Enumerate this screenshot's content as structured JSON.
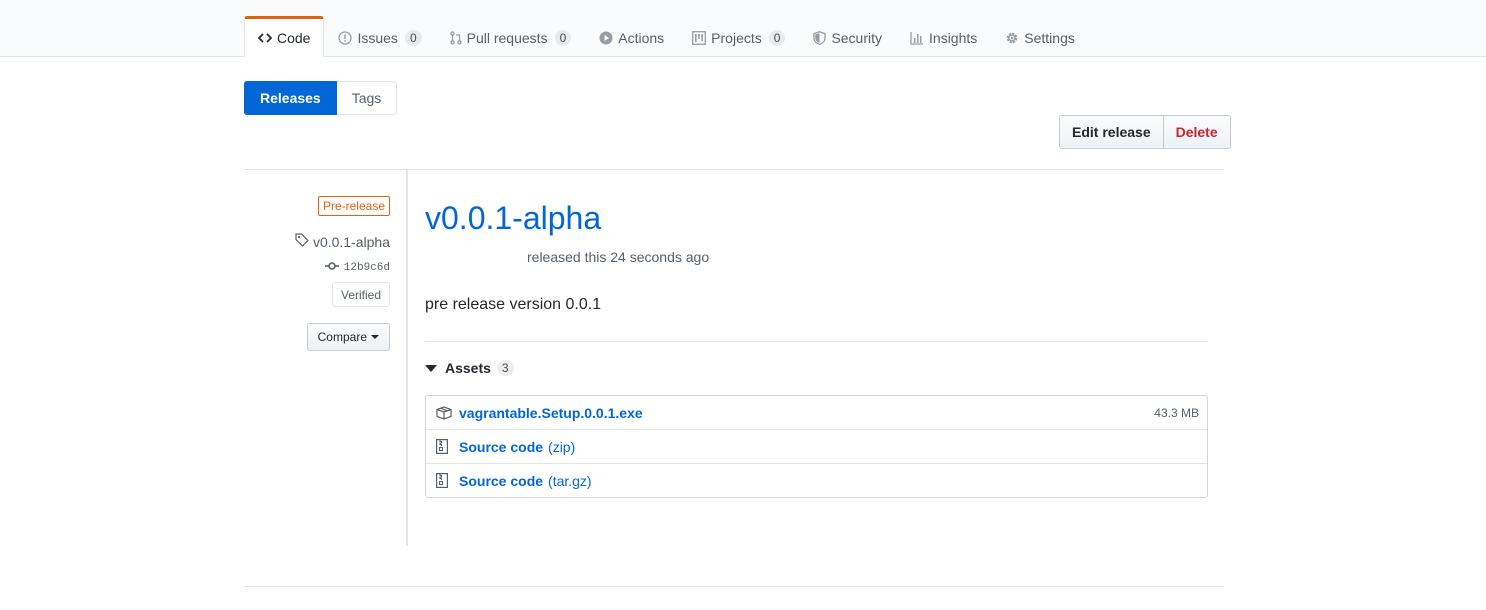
{
  "nav": {
    "tabs": [
      {
        "label": "Code",
        "counter": "",
        "icon": "code-icon"
      },
      {
        "label": "Issues",
        "counter": "0",
        "icon": "issue-icon"
      },
      {
        "label": "Pull requests",
        "counter": "0",
        "icon": "pull-request-icon"
      },
      {
        "label": "Actions",
        "counter": "",
        "icon": "play-icon"
      },
      {
        "label": "Projects",
        "counter": "0",
        "icon": "project-icon"
      },
      {
        "label": "Security",
        "counter": "",
        "icon": "shield-icon"
      },
      {
        "label": "Insights",
        "counter": "",
        "icon": "graph-icon"
      },
      {
        "label": "Settings",
        "counter": "",
        "icon": "gear-icon"
      }
    ],
    "selected_tab": "Code",
    "accent_color": "#e36209"
  },
  "subnav": {
    "releases_label": "Releases",
    "tags_label": "Tags"
  },
  "actions": {
    "edit_label": "Edit release",
    "delete_label": "Delete"
  },
  "release": {
    "prerelease_label": "Pre-release",
    "tag": "v0.0.1-alpha",
    "commit": "12b9c6d",
    "verified_label": "Verified",
    "compare_label": "Compare",
    "title": "v0.0.1-alpha",
    "byline": "released this 24 seconds ago",
    "description": "pre release version 0.0.1"
  },
  "assets": {
    "label": "Assets",
    "count": "3",
    "items": [
      {
        "name": "vagrantable.Setup.0.0.1.exe",
        "suffix": "",
        "size": "43.3 MB",
        "icon": "package-icon"
      },
      {
        "name": "Source code",
        "suffix": "(zip)",
        "size": "",
        "icon": "file-zip-icon"
      },
      {
        "name": "Source code",
        "suffix": "(tar.gz)",
        "size": "",
        "icon": "file-zip-icon"
      }
    ]
  },
  "colors": {
    "link": "#0366d6",
    "danger": "#cb2431",
    "muted": "#586069"
  }
}
